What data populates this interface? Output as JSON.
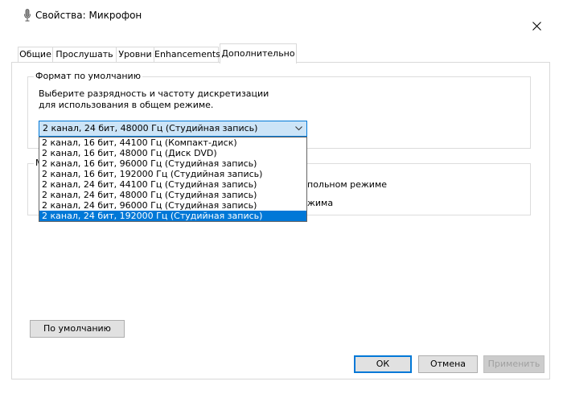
{
  "window": {
    "title": "Свойства: Микрофон",
    "title_icon": "microphone-icon",
    "close_icon": "close-icon"
  },
  "tabs": [
    {
      "label": "Общие",
      "active": false
    },
    {
      "label": "Прослушать",
      "active": false
    },
    {
      "label": "Уровни",
      "active": false
    },
    {
      "label": "Enhancements",
      "active": false
    },
    {
      "label": "Дополнительно",
      "active": true
    }
  ],
  "default_format": {
    "group_label": "Формат по умолчанию",
    "description": "Выберите разрядность и частоту дискретизации для использования в общем режиме.",
    "selected_value": "2 канал, 24 бит, 48000 Гц (Студийная запись)",
    "options": [
      "2 канал, 16 бит, 44100 Гц (Компакт-диск)",
      "2 канал, 16 бит, 48000 Гц (Диск DVD)",
      "2 канал, 16 бит, 96000 Гц (Студийная запись)",
      "2 канал, 16 бит, 192000 Гц (Студийная запись)",
      "2 канал, 24 бит, 44100 Гц (Студийная запись)",
      "2 канал, 24 бит, 48000 Гц (Студийная запись)",
      "2 канал, 24 бит, 96000 Гц (Студийная запись)",
      "2 канал, 24 бит, 192000 Гц (Студийная запись)"
    ],
    "highlighted_option": "2 канал, 24 бит, 192000 Гц (Студийная запись)"
  },
  "exclusive_mode": {
    "group_label_partial": "М",
    "line1_partial": "польном режиме",
    "line2_partial": "жима"
  },
  "buttons": {
    "restore_defaults": "По умолчанию",
    "ok": "ОК",
    "cancel": "Отмена",
    "apply": "Применить"
  },
  "colors": {
    "accent": "#0078d7",
    "combo_fill": "#cce4f7"
  }
}
